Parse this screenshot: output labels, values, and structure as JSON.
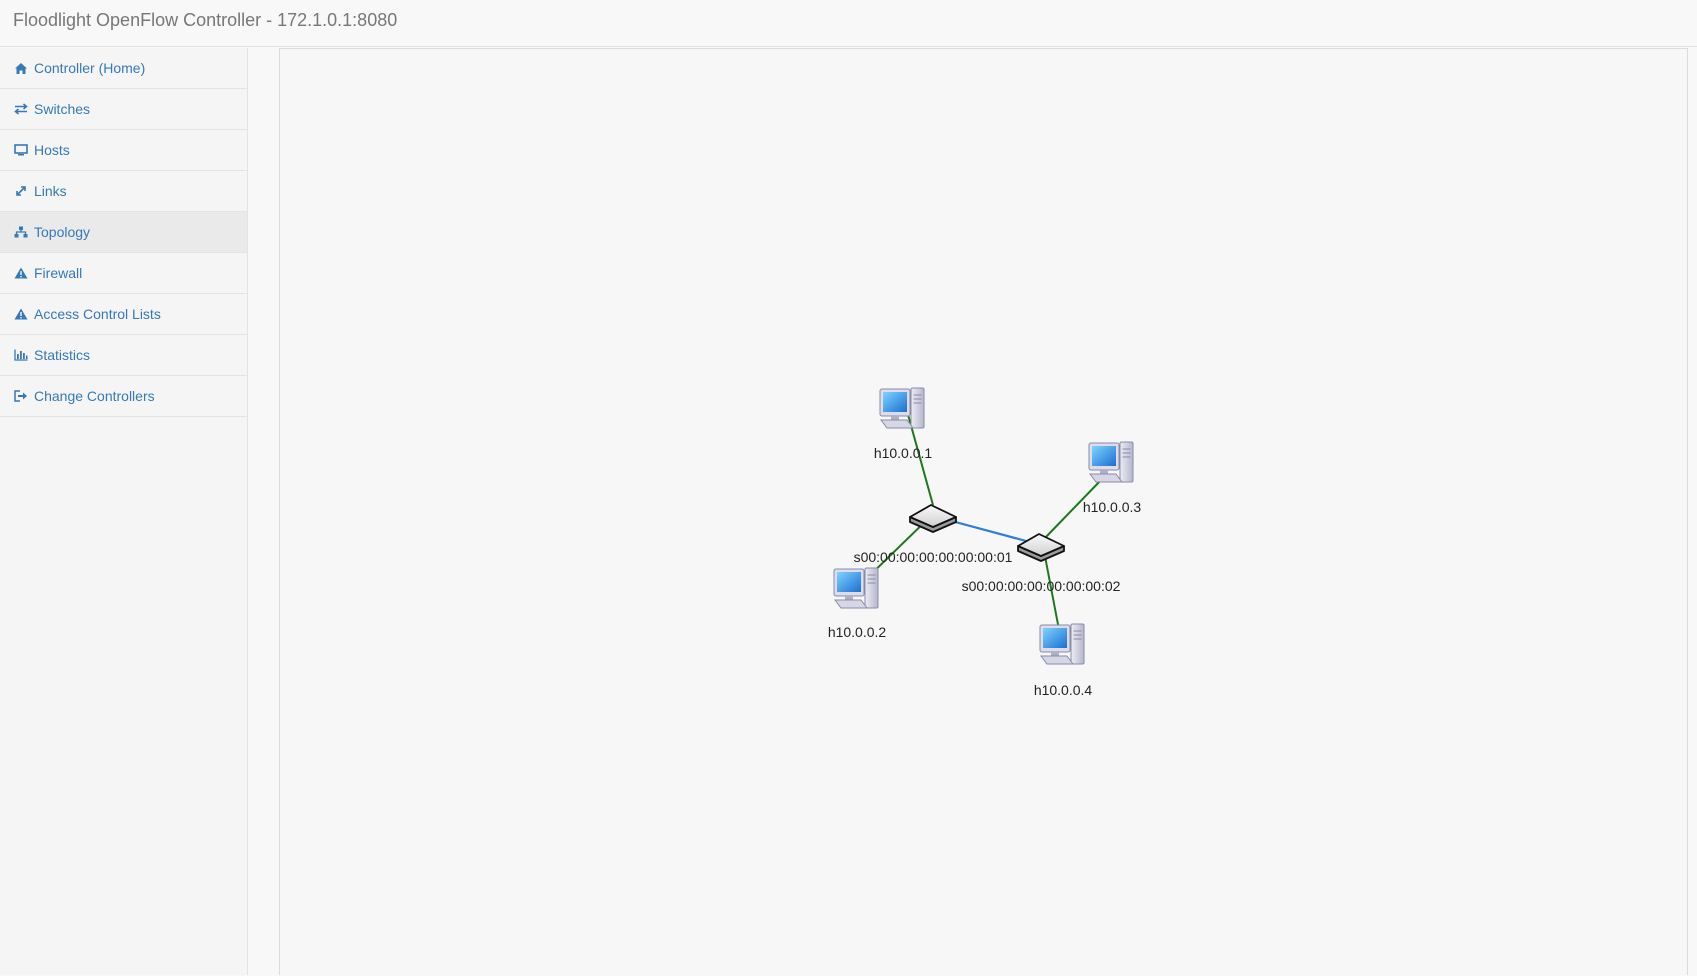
{
  "header": {
    "title": "Floodlight OpenFlow Controller - 172.1.0.1:8080"
  },
  "sidebar": {
    "items": [
      {
        "label": "Controller (Home)",
        "icon": "home-icon"
      },
      {
        "label": "Switches",
        "icon": "exchange-icon"
      },
      {
        "label": "Hosts",
        "icon": "monitor-icon"
      },
      {
        "label": "Links",
        "icon": "expand-arrows-icon"
      },
      {
        "label": "Topology",
        "icon": "sitemap-icon",
        "active": true
      },
      {
        "label": "Firewall",
        "icon": "warning-icon"
      },
      {
        "label": "Access Control Lists",
        "icon": "warning-icon"
      },
      {
        "label": "Statistics",
        "icon": "bar-chart-icon"
      },
      {
        "label": "Change Controllers",
        "icon": "sign-out-icon"
      }
    ]
  },
  "topology": {
    "switches": [
      {
        "id": "s00:00:00:00:00:00:00:01"
      },
      {
        "id": "s00:00:00:00:00:00:00:02"
      }
    ],
    "hosts": [
      {
        "id": "h10.0.0.1"
      },
      {
        "id": "h10.0.0.2"
      },
      {
        "id": "h10.0.0.3"
      },
      {
        "id": "h10.0.0.4"
      }
    ],
    "colors": {
      "switch_link": "#2f7ed8",
      "host_link": "#1a7a1a"
    }
  }
}
